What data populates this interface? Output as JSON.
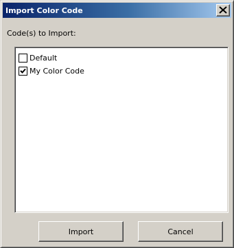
{
  "window": {
    "title": "Import Color Code"
  },
  "icons": {
    "close": "close-icon",
    "check": "checkmark-icon"
  },
  "main": {
    "label": "Code(s) to Import:",
    "items": [
      {
        "label": "Default",
        "checked": false
      },
      {
        "label": "My Color Code",
        "checked": true
      }
    ]
  },
  "buttons": {
    "import_label": "Import",
    "cancel_label": "Cancel"
  },
  "colors": {
    "titlebar_start": "#0a246a",
    "titlebar_end": "#a6caf0",
    "face": "#d4d0c8"
  }
}
